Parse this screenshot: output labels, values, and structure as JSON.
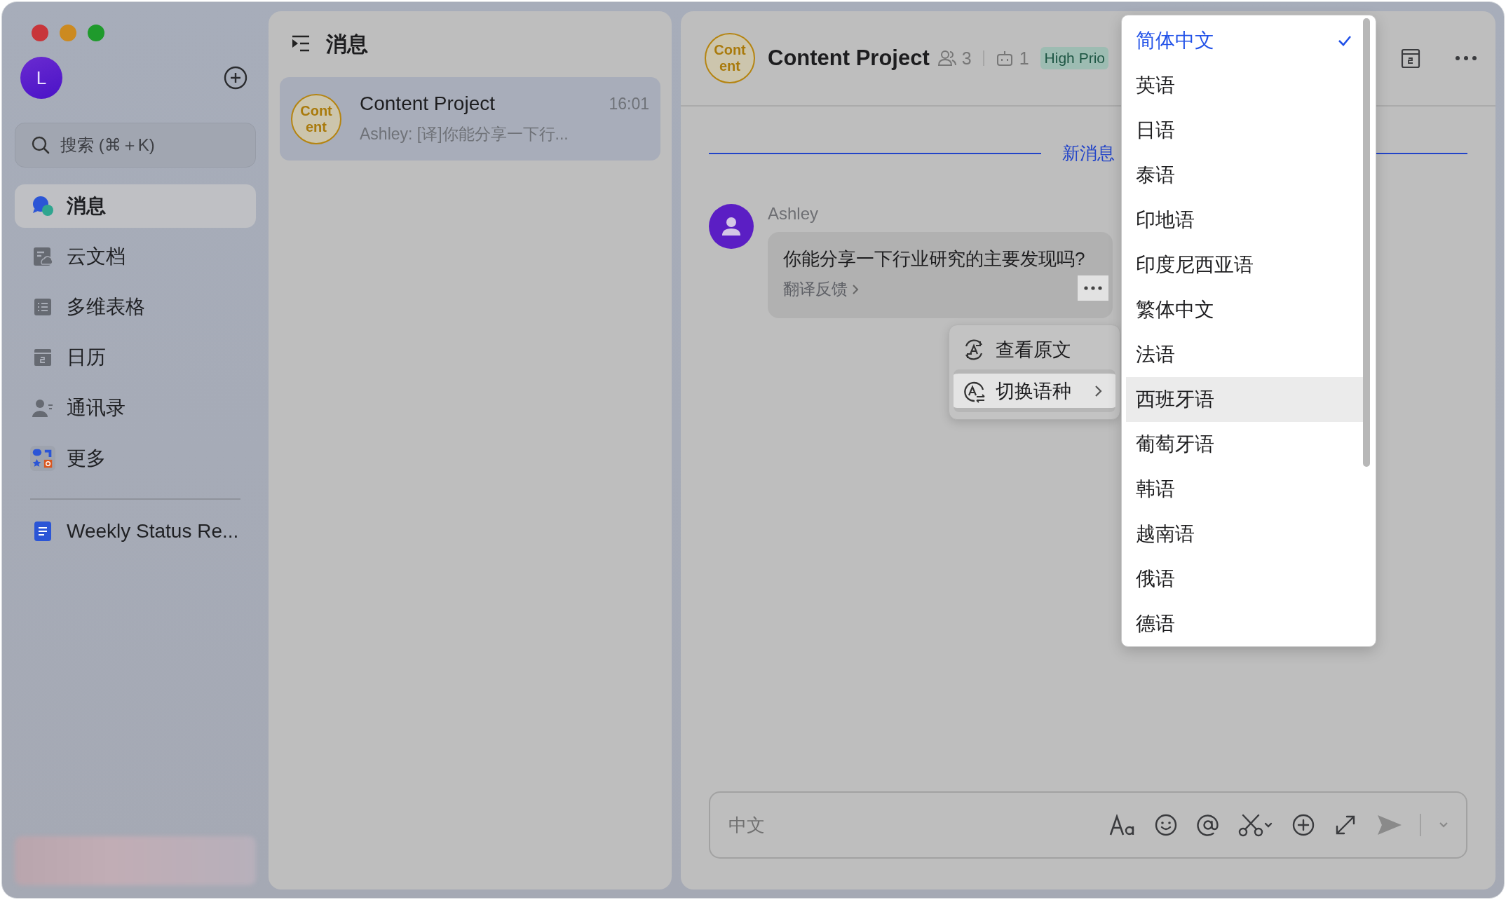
{
  "sidebar": {
    "avatar": "L",
    "search": {
      "placeholder": "搜索 (⌘＋K)"
    },
    "items": [
      {
        "label": "消息",
        "selected": true
      },
      {
        "label": "云文档",
        "selected": false
      },
      {
        "label": "多维表格",
        "selected": false
      },
      {
        "label": "日历",
        "selected": false
      },
      {
        "label": "通讯录",
        "selected": false
      },
      {
        "label": "更多",
        "selected": false
      }
    ],
    "pinned": [
      {
        "label": "Weekly Status Re..."
      }
    ]
  },
  "chat_list": {
    "title": "消息",
    "chats": [
      {
        "avatar": "Content",
        "name": "Content Project",
        "time": "16:01",
        "preview": "Ashley: [译]你能分享一下行...",
        "selected": true
      }
    ]
  },
  "chat": {
    "avatar": "Content",
    "title": "Content Project",
    "members": "3",
    "bots": "1",
    "tag": "High Prio",
    "divider": "新消息",
    "messages": [
      {
        "sender": "Ashley",
        "text": "你能分享一下行业研究的主要发现吗?",
        "feedback": "翻译反馈"
      }
    ],
    "composer": {
      "placeholder": "中文"
    }
  },
  "context_menu": {
    "items": [
      {
        "label": "查看原文",
        "selected": false,
        "submenu": false
      },
      {
        "label": "切换语种",
        "selected": true,
        "submenu": true
      }
    ]
  },
  "language_menu": {
    "items": [
      {
        "label": "简体中文",
        "checked": true,
        "highlighted": false
      },
      {
        "label": "英语",
        "checked": false,
        "highlighted": false
      },
      {
        "label": "日语",
        "checked": false,
        "highlighted": false
      },
      {
        "label": "泰语",
        "checked": false,
        "highlighted": false
      },
      {
        "label": "印地语",
        "checked": false,
        "highlighted": false
      },
      {
        "label": "印度尼西亚语",
        "checked": false,
        "highlighted": false
      },
      {
        "label": "繁体中文",
        "checked": false,
        "highlighted": false
      },
      {
        "label": "法语",
        "checked": false,
        "highlighted": false
      },
      {
        "label": "西班牙语",
        "checked": false,
        "highlighted": true
      },
      {
        "label": "葡萄牙语",
        "checked": false,
        "highlighted": false
      },
      {
        "label": "韩语",
        "checked": false,
        "highlighted": false
      },
      {
        "label": "越南语",
        "checked": false,
        "highlighted": false
      },
      {
        "label": "俄语",
        "checked": false,
        "highlighted": false
      },
      {
        "label": "德语",
        "checked": false,
        "highlighted": false
      }
    ]
  }
}
